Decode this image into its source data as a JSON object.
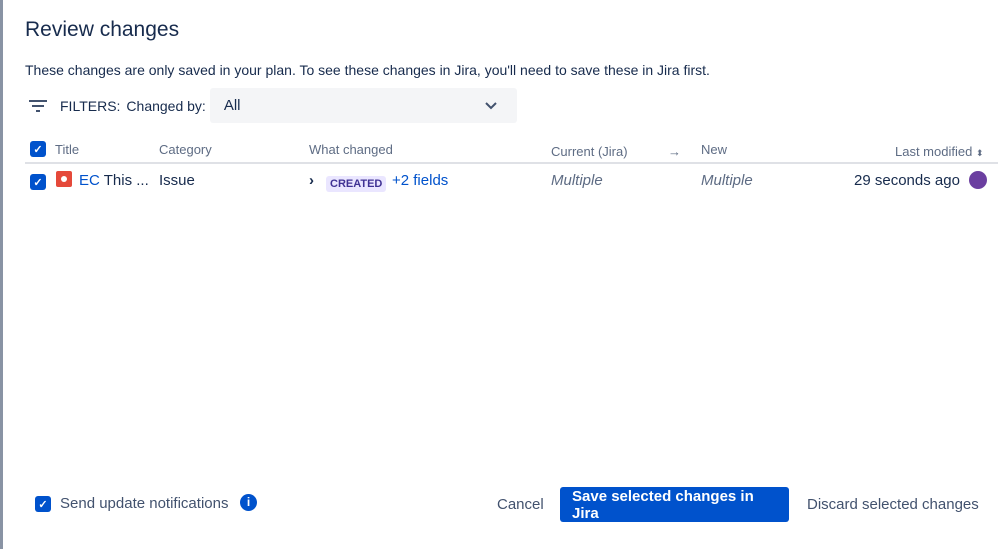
{
  "title": "Review changes",
  "description": "These changes are only saved in your plan. To see these changes in Jira, you'll need to save these in Jira first.",
  "filters": {
    "label": "FILTERS:",
    "changed_by_label": "Changed by:",
    "changed_by_value": "All"
  },
  "table": {
    "headers": {
      "title": "Title",
      "category": "Category",
      "what_changed": "What changed",
      "current": "Current (Jira)",
      "arrow": "→",
      "new": "New",
      "last_modified": "Last modified"
    },
    "rows": [
      {
        "key": "EC",
        "title": "This ...",
        "category": "Issue",
        "status": "CREATED",
        "fields": "+2 fields",
        "current": "Multiple",
        "new": "Multiple",
        "modified": "29 seconds ago"
      }
    ]
  },
  "footer": {
    "notify": "Send update notifications",
    "cancel": "Cancel",
    "save": "Save selected changes in Jira",
    "discard": "Discard selected changes"
  },
  "colors": {
    "primary": "#0052cc",
    "text": "#172b4d"
  }
}
